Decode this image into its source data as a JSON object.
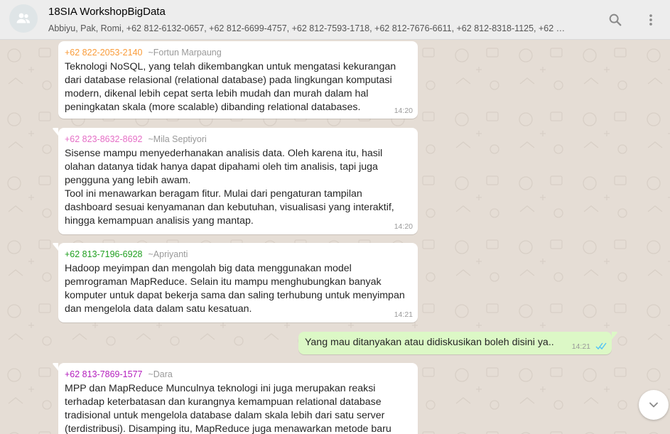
{
  "header": {
    "title": "18SIA WorkshopBigData",
    "participants": "Abbiyu, Pak, Romi, +62 812-6132-0657, +62 812-6699-4757, +62 812-7593-1718, +62 812-7676-6611, +62 812-8318-1125, +62 …"
  },
  "icons": {
    "avatar": "group-icon",
    "search": "search-icon",
    "menu": "more-vert-icon",
    "scroll": "chevron-down-icon",
    "read": "double-check-icon"
  },
  "colors": {
    "header_bg": "#ededed",
    "chat_bg": "#e5ddd5",
    "incoming_bubble": "#ffffff",
    "outgoing_bubble": "#dcf8c6",
    "read_tick": "#4fc3f7"
  },
  "messages": [
    {
      "sender_number": "+62 822-2053-2140",
      "sender_name": "~Fortun Marpaung",
      "sender_color": "#fa9c3a",
      "text": "Teknologi NoSQL, yang telah dikembangkan untuk mengatasi kekurangan dari database relasional (relational database) pada lingkungan komputasi modern, dikenal lebih cepat serta lebih mudah dan murah dalam hal peningkatan skala (more scalable) dibanding relational databases.",
      "time": "14:20"
    },
    {
      "sender_number": "+62 823-8632-8692",
      "sender_name": "~Mila Septiyori",
      "sender_color": "#e56ec6",
      "text": "Sisense mampu menyederhanakan analisis data. Oleh karena itu, hasil olahan datanya tidak hanya dapat dipahami oleh tim analisis, tapi juga pengguna yang lebih awam.\nTool ini menawarkan beragam fitur. Mulai dari pengaturan tampilan dashboard sesuai kenyamanan dan kebutuhan, visualisasi yang interaktif, hingga kemampuan analisis yang mantap.",
      "time": "14:20"
    },
    {
      "sender_number": "+62 813-7196-6928",
      "sender_name": "~Apriyanti",
      "sender_color": "#1f9f1f",
      "text": "Hadoop meyimpan dan mengolah big data menggunakan model pemrograman MapReduce. Selain itu mampu menghubungkan banyak komputer untuk dapat bekerja sama dan saling terhubung untuk menyimpan dan mengelola data dalam satu kesatuan.",
      "time": "14:21"
    },
    {
      "outgoing": true,
      "text": "Yang mau ditanyakan atau didiskusikan boleh disini ya..",
      "time": "14:21"
    },
    {
      "sender_number": "+62 813-7869-1577",
      "sender_name": "~Dara",
      "sender_color": "#b41ebd",
      "text": "MPP dan MapReduce Munculnya teknologi ini juga merupakan reaksi terhadap keterbatasan dan kurangnya kemampuan relational database tradisional untuk mengelola database dalam skala lebih dari satu server (terdistribusi). Disamping itu, MapReduce juga menawarkan metode baru",
      "time": ""
    }
  ]
}
